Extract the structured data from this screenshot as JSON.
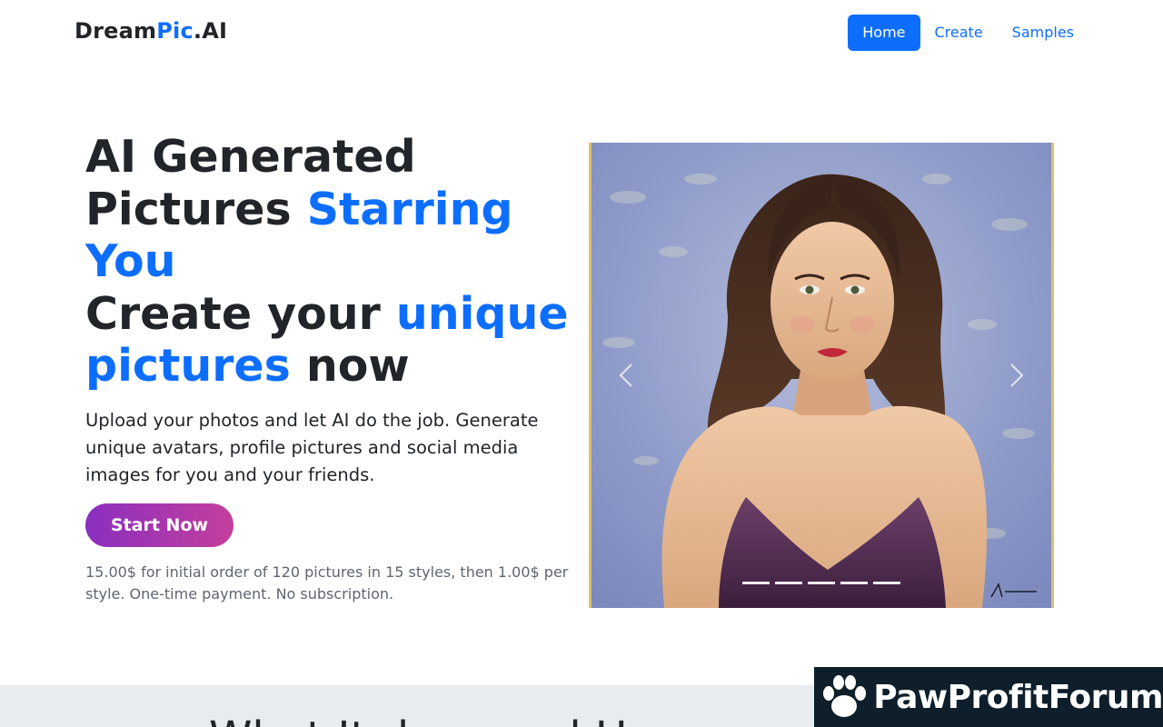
{
  "brand": {
    "part1": "Dream",
    "part2": "Pic",
    "part3": ".AI"
  },
  "nav": {
    "items": [
      {
        "label": "Home",
        "active": true
      },
      {
        "label": "Create"
      },
      {
        "label": "Samples"
      }
    ]
  },
  "hero": {
    "title_line1": "AI Generated",
    "title_line2_a": "Pictures ",
    "title_line2_b": "Starring",
    "title_line3": "You",
    "title_line4_a": "Create your ",
    "title_line4_b": "unique",
    "title_line5_a": "pictures",
    "title_line5_b": " now",
    "lead": "Upload your photos and let AI do the job. Generate unique avatars, profile pictures and social media images for you and your friends.",
    "cta_label": "Start Now",
    "price_note": "15.00$ for initial order of 120 pictures in 15 styles, then 1.00$ per style. One-time payment. No subscription."
  },
  "carousel": {
    "slide_count": 5,
    "active_index": 0,
    "prev_icon": "chevron-left-icon",
    "next_icon": "chevron-right-icon"
  },
  "section": {
    "heading": "What It does and How"
  },
  "watermark": {
    "text": "PawProfitForum",
    "icon": "paw-icon"
  },
  "colors": {
    "primary": "#0d6efd",
    "cta_start": "#8a2fc0",
    "cta_end": "#c43f9c",
    "band": "#e9ecef",
    "watermark_bg": "#0e1f2b"
  }
}
